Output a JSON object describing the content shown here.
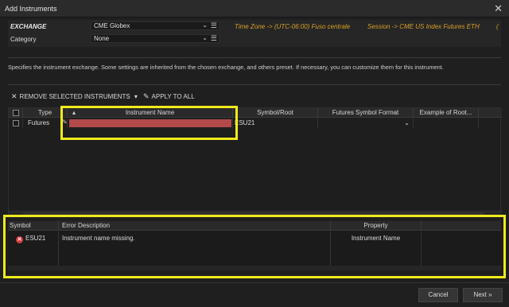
{
  "window": {
    "title": "Add Instruments",
    "close_icon": "close-icon"
  },
  "exchange_panel": {
    "exchange_label": "EXCHANGE",
    "exchange_value": "CME Globex",
    "category_label": "Category",
    "category_value": "None",
    "timezone_text": "Time Zone -> (UTC-06:00) Fuso centrale",
    "session_text": "Session -> CME US Index Futures ETH",
    "overflow_text": "("
  },
  "description": "Specifies the instrument exchange. Some settings are inherited from the chosen exchange, and others preset. If necessary, you can customize them for this instrument.",
  "toolbar": {
    "remove_label": "REMOVE SELECTED INSTRUMENTS",
    "apply_label": "APPLY TO ALL"
  },
  "grid": {
    "columns": [
      "Type",
      "Instrument Name",
      "Symbol/Root",
      "Futures Symbol Format",
      "Example of Root..."
    ],
    "rows": [
      {
        "type": "Futures",
        "instrument_name": "",
        "symbol": "ESU21",
        "format": ""
      }
    ]
  },
  "errors": {
    "columns": [
      "Symbol",
      "Error Description",
      "Property"
    ],
    "rows": [
      {
        "symbol": "ESU21",
        "description": "Instrument name missing.",
        "property": "Instrument Name"
      }
    ]
  },
  "footer": {
    "cancel_label": "Cancel",
    "next_label": "Next »"
  },
  "colors": {
    "highlight": "#f0ea1c",
    "accent_text": "#d9a028",
    "error_cell": "#b24a4a",
    "error_icon": "#d93a3a"
  }
}
